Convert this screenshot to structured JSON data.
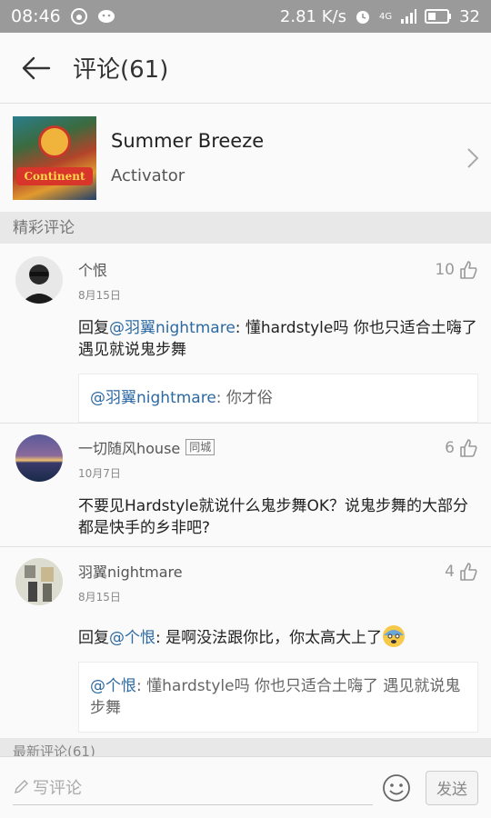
{
  "status_bar": {
    "time": "08:46",
    "network_speed": "2.81 K/s",
    "signal_label": "4G",
    "battery": "32"
  },
  "header": {
    "title": "评论(61)"
  },
  "song": {
    "name": "Summer Breeze",
    "artist": "Activator",
    "cover_text": "Continent"
  },
  "sections": {
    "featured": "精彩评论",
    "latest": "最新评论(61)"
  },
  "comments": [
    {
      "username": "个恨",
      "date": "8月15日",
      "likes": "10",
      "reply_prefix": "回复",
      "reply_mention": "@羽翼nightmare",
      "body": ": 懂hardstyle吗 你也只适合土嗨了 遇见就说鬼步舞",
      "quote_mention": "@羽翼nightmare",
      "quote_text": ": 你才俗"
    },
    {
      "username": "一切随风house",
      "tag": "同城",
      "date": "10月7日",
      "likes": "6",
      "body": "不要见Hardstyle就说什么鬼步舞OK？说鬼步舞的大部分都是快手的乡非吧?"
    },
    {
      "username": "羽翼nightmare",
      "date": "8月15日",
      "likes": "4",
      "reply_prefix": "回复",
      "reply_mention": "@个恨",
      "body": ": 是啊没法跟你比，你太高大上了",
      "quote_mention": "@个恨",
      "quote_text": ": 懂hardstyle吗 你也只适合土嗨了 遇见就说鬼步舞"
    }
  ],
  "input_bar": {
    "placeholder": "写评论",
    "send_label": "发送"
  },
  "icons": {
    "back": "arrow-left-icon",
    "chevron": "chevron-right-icon",
    "like": "thumbs-up-icon",
    "emoji": "smiley-icon",
    "pen": "pencil-icon"
  }
}
